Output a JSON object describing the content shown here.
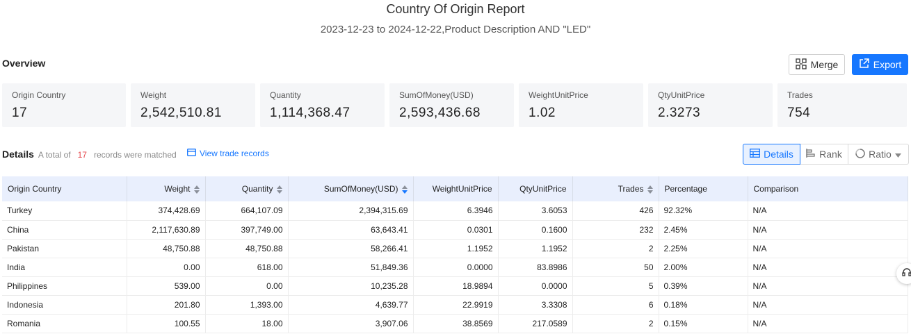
{
  "header": {
    "title": "Country Of Origin Report",
    "subtitle": "2023-12-23 to 2024-12-22,Product Description AND \"LED\""
  },
  "overview": {
    "label": "Overview",
    "merge_label": "Merge",
    "export_label": "Export",
    "stats": [
      {
        "label": "Origin Country",
        "value": "17"
      },
      {
        "label": "Weight",
        "value": "2,542,510.81"
      },
      {
        "label": "Quantity",
        "value": "1,114,368.47"
      },
      {
        "label": "SumOfMoney(USD)",
        "value": "2,593,436.68"
      },
      {
        "label": "WeightUnitPrice",
        "value": "1.02"
      },
      {
        "label": "QtyUnitPrice",
        "value": "2.3273"
      },
      {
        "label": "Trades",
        "value": "754"
      }
    ]
  },
  "details": {
    "label": "Details",
    "prefix": "A total of",
    "count": "17",
    "suffix": "records were matched",
    "view_link": "View trade records",
    "view_details": "Details",
    "view_rank": "Rank",
    "view_ratio": "Ratio"
  },
  "table": {
    "columns": [
      "Origin Country",
      "Weight",
      "Quantity",
      "SumOfMoney(USD)",
      "WeightUnitPrice",
      "QtyUnitPrice",
      "Trades",
      "Percentage",
      "Comparison"
    ],
    "rows": [
      [
        "Turkey",
        "374,428.69",
        "664,107.09",
        "2,394,315.69",
        "6.3946",
        "3.6053",
        "426",
        "92.32%",
        "N/A"
      ],
      [
        "China",
        "2,117,630.89",
        "397,749.00",
        "63,643.41",
        "0.0301",
        "0.1600",
        "232",
        "2.45%",
        "N/A"
      ],
      [
        "Pakistan",
        "48,750.88",
        "48,750.88",
        "58,266.41",
        "1.1952",
        "1.1952",
        "2",
        "2.25%",
        "N/A"
      ],
      [
        "India",
        "0.00",
        "618.00",
        "51,849.36",
        "0.0000",
        "83.8986",
        "50",
        "2.00%",
        "N/A"
      ],
      [
        "Philippines",
        "539.00",
        "0.00",
        "10,235.28",
        "18.9894",
        "0.0000",
        "5",
        "0.39%",
        "N/A"
      ],
      [
        "Indonesia",
        "201.80",
        "1,393.00",
        "4,639.77",
        "22.9919",
        "3.3308",
        "6",
        "0.18%",
        "N/A"
      ],
      [
        "Romania",
        "100.55",
        "18.00",
        "3,907.06",
        "38.8569",
        "217.0589",
        "2",
        "0.15%",
        "N/A"
      ]
    ]
  }
}
